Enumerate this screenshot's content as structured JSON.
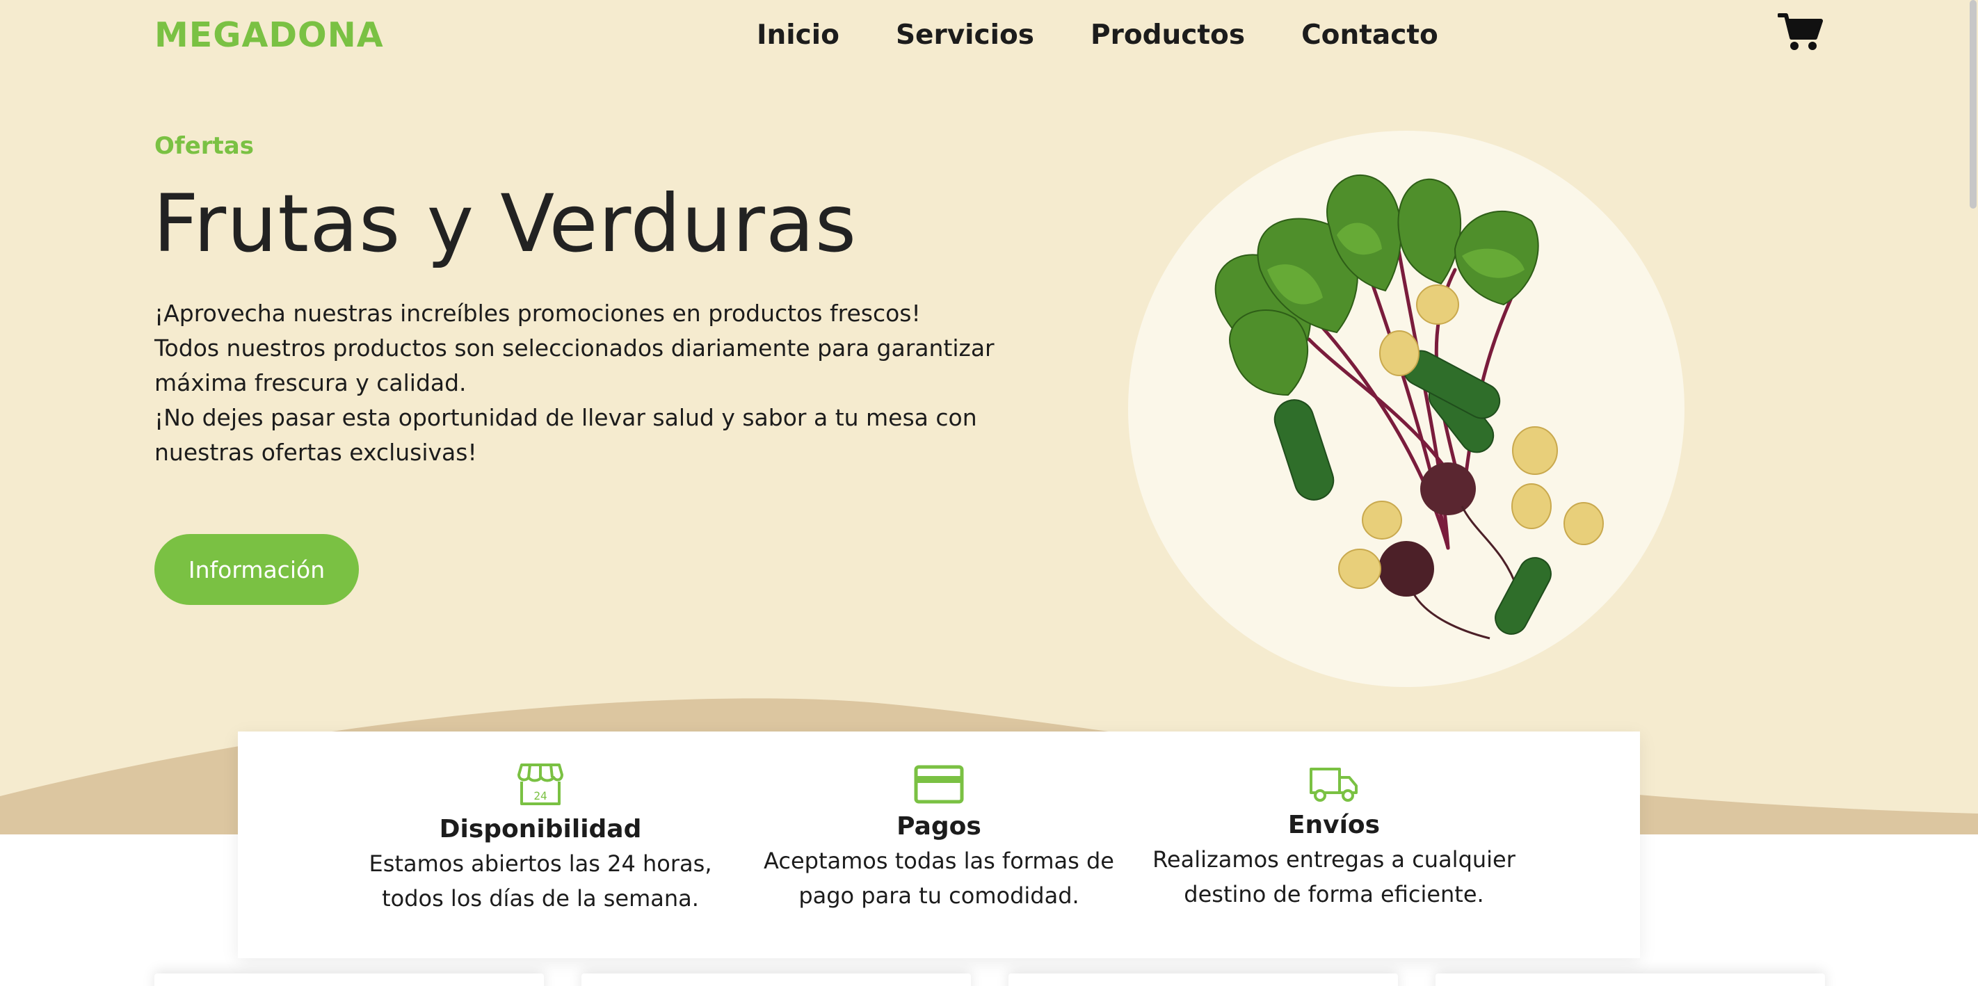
{
  "header": {
    "logo": "MEGADONA",
    "nav": [
      "Inicio",
      "Servicios",
      "Productos",
      "Contacto"
    ],
    "cart_icon": "shopping-cart-icon"
  },
  "hero": {
    "eyebrow": "Ofertas",
    "title": "Frutas y Verduras",
    "description_lines": [
      "¡Aprovecha nuestras increíbles promociones en productos frescos!",
      "Todos nuestros productos son seleccionados diariamente para garantizar",
      "máxima frescura y calidad.",
      "¡No dejes pasar esta oportunidad de llevar salud y sabor a tu mesa con",
      "nuestras ofertas exclusivas!"
    ],
    "button": "Información"
  },
  "features": [
    {
      "icon": "store-24h-icon",
      "title": "Disponibilidad",
      "desc_lines": [
        "Estamos abiertos las 24 horas,",
        "todos los días de la semana."
      ]
    },
    {
      "icon": "credit-card-icon",
      "title": "Pagos",
      "desc_lines": [
        "Aceptamos todas las formas de",
        "pago para tu comodidad."
      ]
    },
    {
      "icon": "delivery-truck-icon",
      "title": "Envíos",
      "desc_lines": [
        "Realizamos entregas a cualquier",
        "destino de forma eficiente."
      ]
    }
  ],
  "colors": {
    "accent": "#7ac143",
    "hero_bg": "#f5ebcf",
    "wave": "#dcc6a0",
    "text": "#1c1c1c"
  }
}
